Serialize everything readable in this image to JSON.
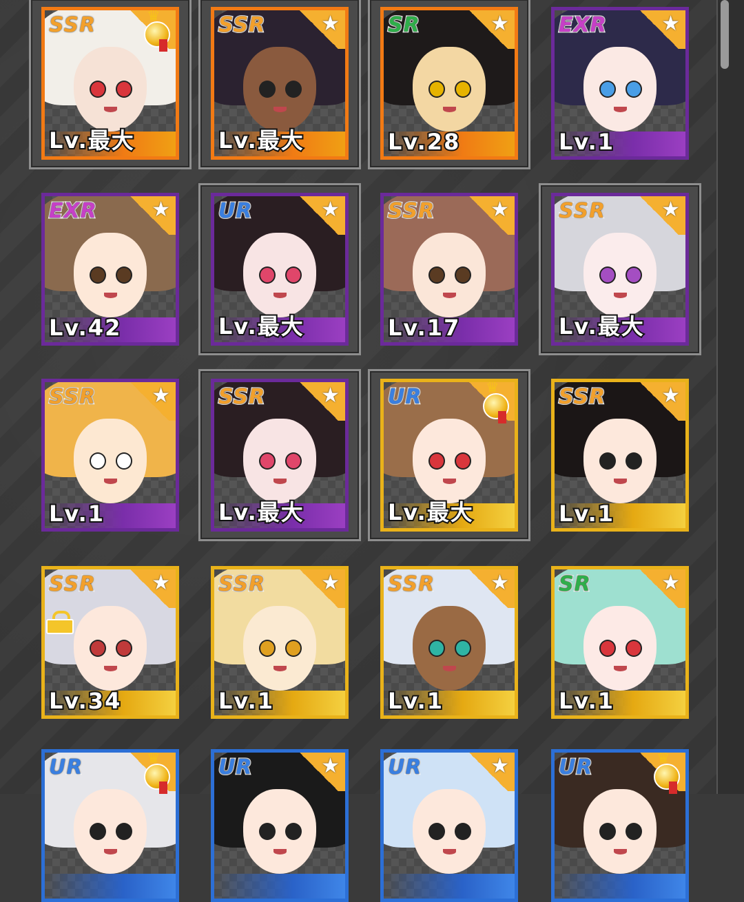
{
  "colors": {
    "background": "#3a3a3a",
    "frame_orange": "#f27a14",
    "frame_purple": "#6b2a9a",
    "frame_gold": "#e9b21a",
    "frame_blue": "#2c6fd6"
  },
  "cards": [
    {
      "rarity": "SSR",
      "level": "Lv.最大",
      "badge": "medal",
      "frame": "orange",
      "hair": "#f2efe9",
      "skin": "#f6e2d6",
      "eye": "#d9363c"
    },
    {
      "rarity": "SSR",
      "level": "Lv.最大",
      "badge": "star",
      "frame": "orange",
      "hair": "#2b2230",
      "skin": "#8a5a3e",
      "eye": "#222"
    },
    {
      "rarity": "SR",
      "level": "Lv.28",
      "badge": "star",
      "frame": "orange",
      "hair": "#1e1a1a",
      "skin": "#f3d7a3",
      "eye": "#e6b300"
    },
    {
      "rarity": "EXR",
      "level": "Lv.1",
      "badge": "star",
      "frame": "purple",
      "hair": "#2d2a4a",
      "skin": "#fbe9e4",
      "eye": "#4a9ee6"
    },
    {
      "rarity": "EXR",
      "level": "Lv.42",
      "badge": "star",
      "frame": "purple",
      "hair": "#8a6a4e",
      "skin": "#fde8d8",
      "eye": "#5a3b22"
    },
    {
      "rarity": "UR",
      "level": "Lv.最大",
      "badge": "star",
      "frame": "purple",
      "hair": "#2a1e22",
      "skin": "#f8e4e4",
      "eye": "#e0466a"
    },
    {
      "rarity": "SSR",
      "level": "Lv.17",
      "badge": "star",
      "frame": "purple",
      "hair": "#9b6a58",
      "skin": "#fbe6d8",
      "eye": "#5a3b22"
    },
    {
      "rarity": "SSR",
      "level": "Lv.最大",
      "badge": "star",
      "frame": "purple",
      "hair": "#d6d6dc",
      "skin": "#fbecec",
      "eye": "#a44ec2"
    },
    {
      "rarity": "SSR",
      "level": "Lv.1",
      "badge": "star",
      "frame": "purple",
      "hair": "#f0b44a",
      "skin": "#fde8d2",
      "eye": "#ffffff"
    },
    {
      "rarity": "SSR",
      "level": "Lv.最大",
      "badge": "star",
      "frame": "purple",
      "hair": "#2a1e22",
      "skin": "#f8e4e4",
      "eye": "#e0466a"
    },
    {
      "rarity": "UR",
      "level": "Lv.最大",
      "badge": "medal",
      "frame": "gold",
      "hair": "#9a6e4a",
      "skin": "#fde8dc",
      "eye": "#d9363c"
    },
    {
      "rarity": "SSR",
      "level": "Lv.1",
      "badge": "star",
      "frame": "gold",
      "hair": "#1b1616",
      "skin": "#fde8dc",
      "eye": "#222"
    },
    {
      "rarity": "SSR",
      "level": "Lv.34",
      "badge": "star",
      "lock": true,
      "frame": "gold",
      "hair": "#d8d8e2",
      "skin": "#fde8dc",
      "eye": "#c03a3a"
    },
    {
      "rarity": "SSR",
      "level": "Lv.1",
      "badge": "star",
      "frame": "gold",
      "hair": "#f2dca0",
      "skin": "#fbead2",
      "eye": "#e0a020"
    },
    {
      "rarity": "SSR",
      "level": "Lv.1",
      "badge": "star",
      "frame": "gold",
      "hair": "#dfe6f2",
      "skin": "#9a6a44",
      "eye": "#2fb4a4"
    },
    {
      "rarity": "SR",
      "level": "Lv.1",
      "badge": "star",
      "frame": "gold",
      "hair": "#9ee0d0",
      "skin": "#fdeae6",
      "eye": "#d9363c"
    },
    {
      "rarity": "UR",
      "level": "",
      "badge": "medal",
      "frame": "blue",
      "hair": "#e6e6ea",
      "skin": "#fde8dc",
      "eye": "#222"
    },
    {
      "rarity": "UR",
      "level": "",
      "badge": "star",
      "frame": "blue",
      "hair": "#1a1a1a",
      "skin": "#fde8dc",
      "eye": "#222"
    },
    {
      "rarity": "UR",
      "level": "",
      "badge": "star",
      "frame": "blue",
      "hair": "#cfe2f6",
      "skin": "#fde8dc",
      "eye": "#222"
    },
    {
      "rarity": "UR",
      "level": "",
      "badge": "medal",
      "frame": "blue",
      "hair": "#3a2a22",
      "skin": "#fde8dc",
      "eye": "#222"
    }
  ]
}
